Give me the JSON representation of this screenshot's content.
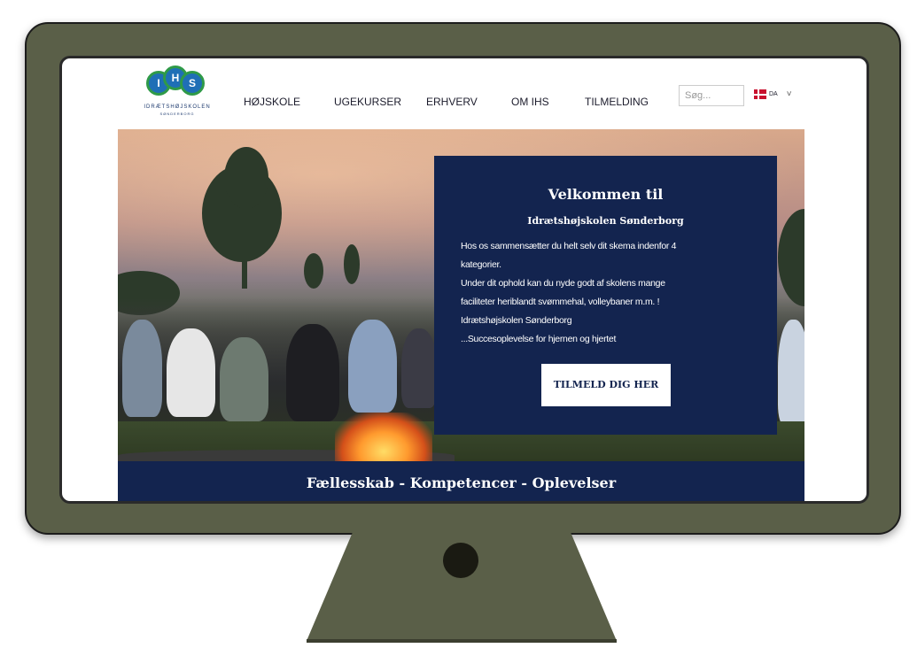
{
  "logo": {
    "initials": [
      "I",
      "H",
      "S"
    ],
    "name": "IDRÆTSHØJSKOLEN",
    "sub": "SØNDERBORG"
  },
  "nav": {
    "items": [
      "HØJSKOLE",
      "UGEKURSER",
      "ERHVERV",
      "OM IHS",
      "TILMELDING"
    ],
    "search_placeholder": "Søg...",
    "lang_code": "DA",
    "lang_chevron": "˅"
  },
  "hero": {
    "title": "Velkommen til",
    "subtitle": "Idrætshøjskolen Sønderborg",
    "body_lines": [
      "Hos os sammensætter du helt selv dit skema indenfor 4",
      "kategorier.",
      "Under dit ophold kan du nyde godt af skolens mange",
      "faciliteter heriblandt svømmehal, volleybaner m.m. !",
      "Idrætshøjskolen Sønderborg",
      "...Succesoplevelse for hjernen og hjertet"
    ],
    "cta_label": "TILMELD DIG HER"
  },
  "tagline": "Fællesskab - Kompetencer - Oplevelser",
  "colors": {
    "navy": "#13244f",
    "monitor": "#5a5f48",
    "flag_red": "#c8102e"
  }
}
